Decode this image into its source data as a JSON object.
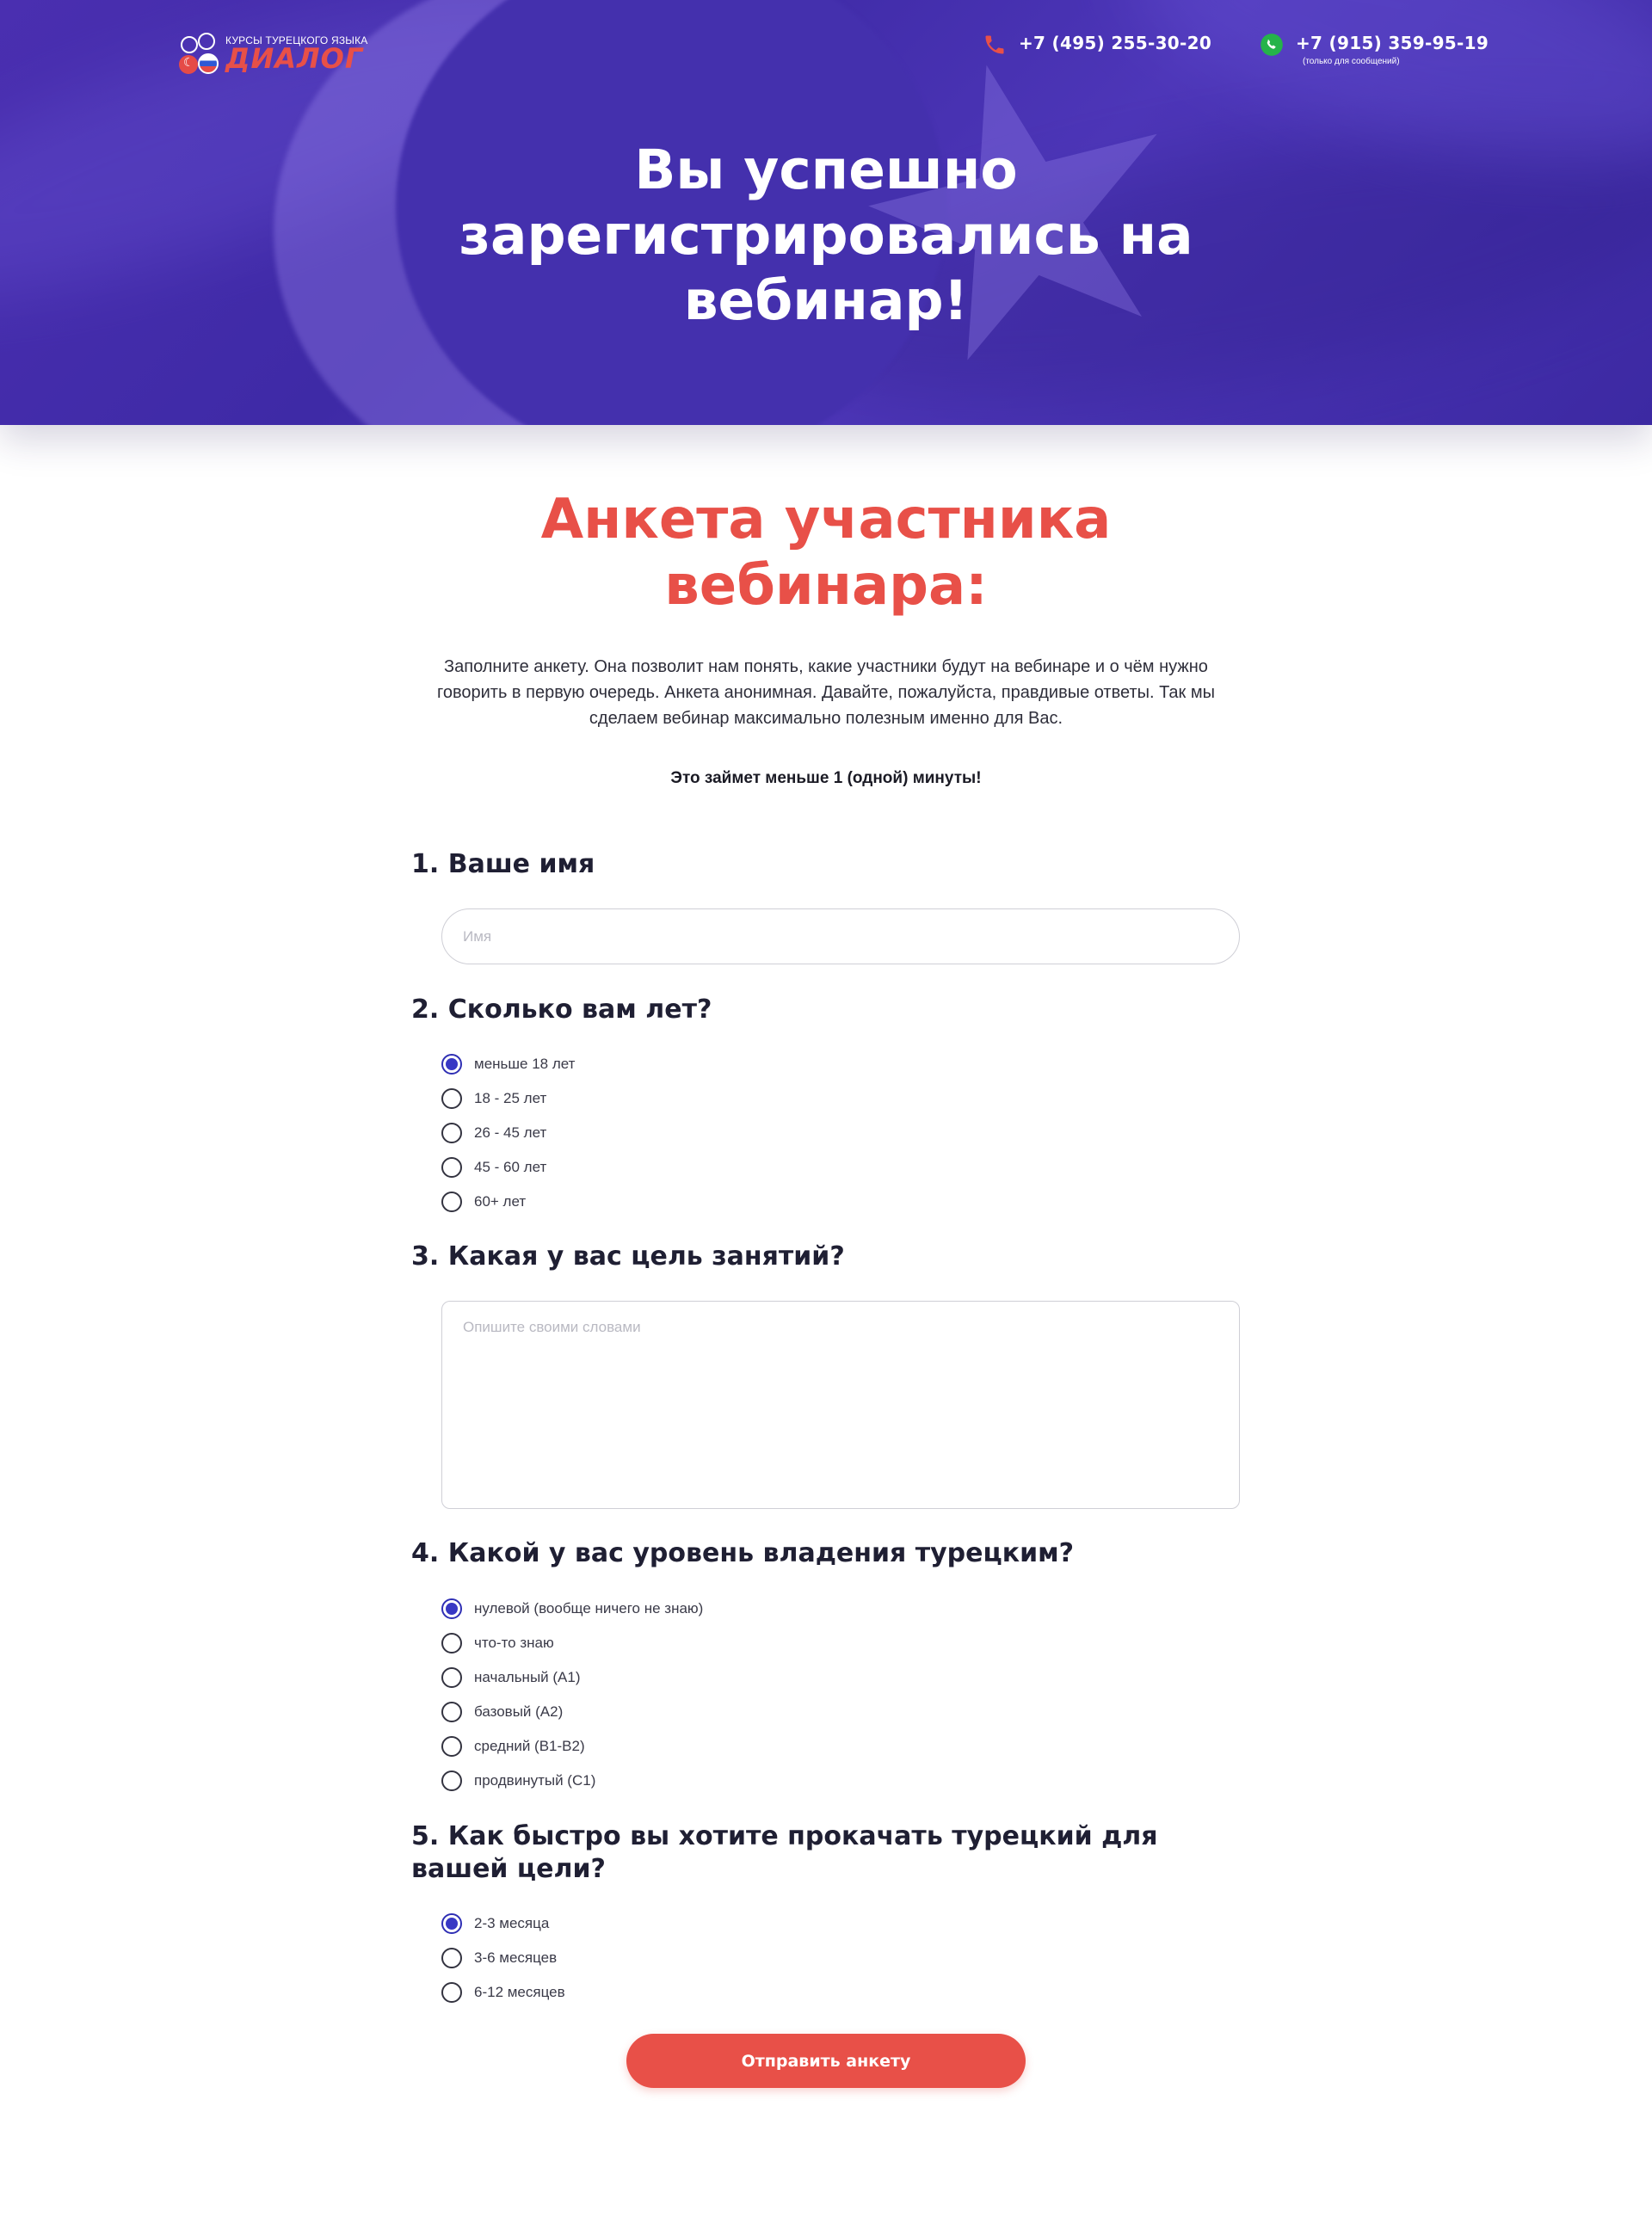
{
  "header": {
    "logo_tagline": "КУРСЫ ТУРЕЦКОГО ЯЗЫКА",
    "logo_brand": "ДИАЛОГ",
    "phone": "+7 (495) 255-30-20",
    "whatsapp": "+7 (915) 359-95-19",
    "whatsapp_note": "(только для сообщений)"
  },
  "hero": {
    "title": "Вы успешно зарегистрировались на вебинар!"
  },
  "survey": {
    "title": "Анкета участника вебинара:",
    "intro": "Заполните анкету. Она позволит нам понять, какие участники будут на вебинаре и о чём нужно говорить в первую очередь. Анкета анонимная. Давайте, пожалуйста, правдивые ответы. Так мы сделаем вебинар максимально полезным именно для Вас.",
    "note": "Это займет меньше 1 (одной) минуты!",
    "q1": {
      "title": "1. Ваше имя",
      "placeholder": "Имя"
    },
    "q2": {
      "title": "2. Сколько вам лет?",
      "options": [
        "меньше 18 лет",
        "18 - 25 лет",
        "26 - 45 лет",
        "45 - 60 лет",
        "60+ лет"
      ],
      "selected": "меньше 18 лет"
    },
    "q3": {
      "title": "3. Какая у вас цель занятий?",
      "placeholder": "Опишите своими словами"
    },
    "q4": {
      "title": "4. Какой у вас уровень владения турецким?",
      "options": [
        "нулевой (вообще ничего не знаю)",
        "что-то знаю",
        "начальный (А1)",
        "базовый (А2)",
        "средний (В1-В2)",
        "продвинутый (С1)"
      ],
      "selected": "нулевой (вообще ничего не знаю)"
    },
    "q5": {
      "title": "5. Как быстро вы хотите прокачать турецкий для вашей цели?",
      "options": [
        "2-3 месяца",
        "3-6 месяцев",
        "6-12 месяцев"
      ],
      "selected": "2-3 месяца"
    },
    "submit_label": "Отправить анкету"
  },
  "colors": {
    "hero_purple": "#4430ad",
    "accent_red": "#e85048",
    "radio_blue": "#3838c4",
    "whatsapp_green": "#25b34a"
  },
  "icons": {
    "phone": "phone-icon",
    "whatsapp": "whatsapp-icon"
  }
}
